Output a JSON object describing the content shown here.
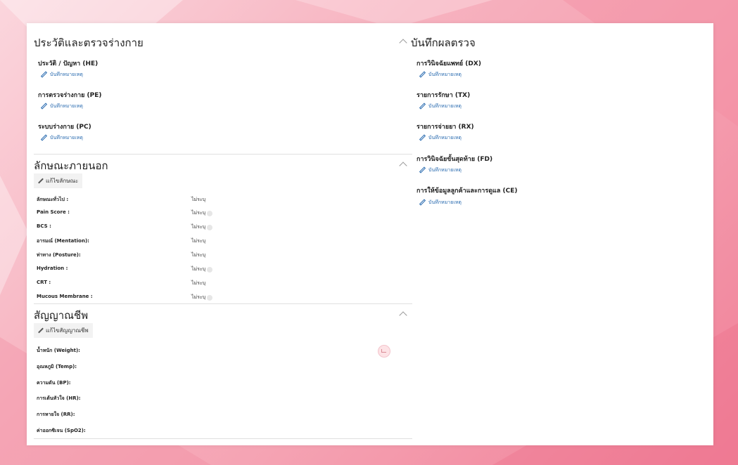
{
  "history_section": {
    "title": "ประวัติและตรวจร่างกาย",
    "items": [
      {
        "label": "ประวัติ / ปัญหา (HE)",
        "note": "บันทึกหมายเหตุ"
      },
      {
        "label": "การตรวจร่างกาย (PE)",
        "note": "บันทึกหมายเหตุ"
      },
      {
        "label": "ระบบร่างกาย (PC)",
        "note": "บันทึกหมายเหตุ"
      }
    ]
  },
  "appearance_section": {
    "title": "ลักษณะภายนอก",
    "edit_label": "แก้ไขลักษณะ",
    "rows": [
      {
        "label": "ลักษณะทั่วไป :",
        "value": "ไม่ระบุ"
      },
      {
        "label": "Pain Score :",
        "value": "ไม่ระบุ"
      },
      {
        "label": "BCS :",
        "value": "ไม่ระบุ"
      },
      {
        "label": "อารมณ์ (Mentation):",
        "value": "ไม่ระบุ"
      },
      {
        "label": "ท่าทาง (Posture):",
        "value": "ไม่ระบุ"
      },
      {
        "label": "Hydration :",
        "value": "ไม่ระบุ"
      },
      {
        "label": "CRT :",
        "value": "ไม่ระบุ"
      },
      {
        "label": "Mucous Membrane :",
        "value": "ไม่ระบุ"
      }
    ]
  },
  "vitals_section": {
    "title": "สัญญาณชีพ",
    "edit_label": "แก้ไขสัญญาณชีพ",
    "rows": [
      {
        "label": "น้ำหนัก (Weight):"
      },
      {
        "label": "อุณหภูมิ (Temp):"
      },
      {
        "label": "ความดัน (BP):"
      },
      {
        "label": "การเต้นหัวใจ (HR):"
      },
      {
        "label": "การหายใจ (RR):"
      },
      {
        "label": "ค่าออกซิเจน (SpO2):"
      }
    ]
  },
  "results_section": {
    "title": "บันทึกผลตรวจ",
    "items": [
      {
        "label": "การวินิจฉัยแพทย์ (DX)",
        "note": "บันทึกหมายเหตุ"
      },
      {
        "label": "รายการรักษา (TX)",
        "note": "บันทึกหมายเหตุ"
      },
      {
        "label": "รายการจ่ายยา (RX)",
        "note": "บันทึกหมายเหตุ"
      },
      {
        "label": "การวินิจฉัยขั้นสุดท้าย (FD)",
        "note": "บันทึกหมายเหตุ"
      },
      {
        "label": "การให้ข้อมูลลูกค้าและการดูแล (CE)",
        "note": "บันทึกหมายเหตุ"
      }
    ]
  }
}
